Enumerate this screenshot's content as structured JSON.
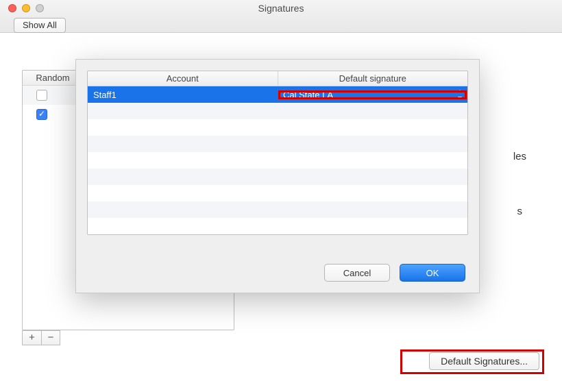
{
  "window": {
    "title": "Signatures",
    "show_all_label": "Show All"
  },
  "left_panel": {
    "header_random": "Random",
    "rows": [
      {
        "checked": false
      },
      {
        "checked": true
      }
    ],
    "add_label": "+",
    "remove_label": "−"
  },
  "obscured": {
    "hint1": "les",
    "hint2": "s"
  },
  "dialog": {
    "columns": {
      "account": "Account",
      "default_signature": "Default signature"
    },
    "rows": [
      {
        "account": "Staff1",
        "default_signature": "Cal State LA"
      }
    ],
    "cancel_label": "Cancel",
    "ok_label": "OK"
  },
  "bottom": {
    "default_signatures_label": "Default Signatures..."
  }
}
